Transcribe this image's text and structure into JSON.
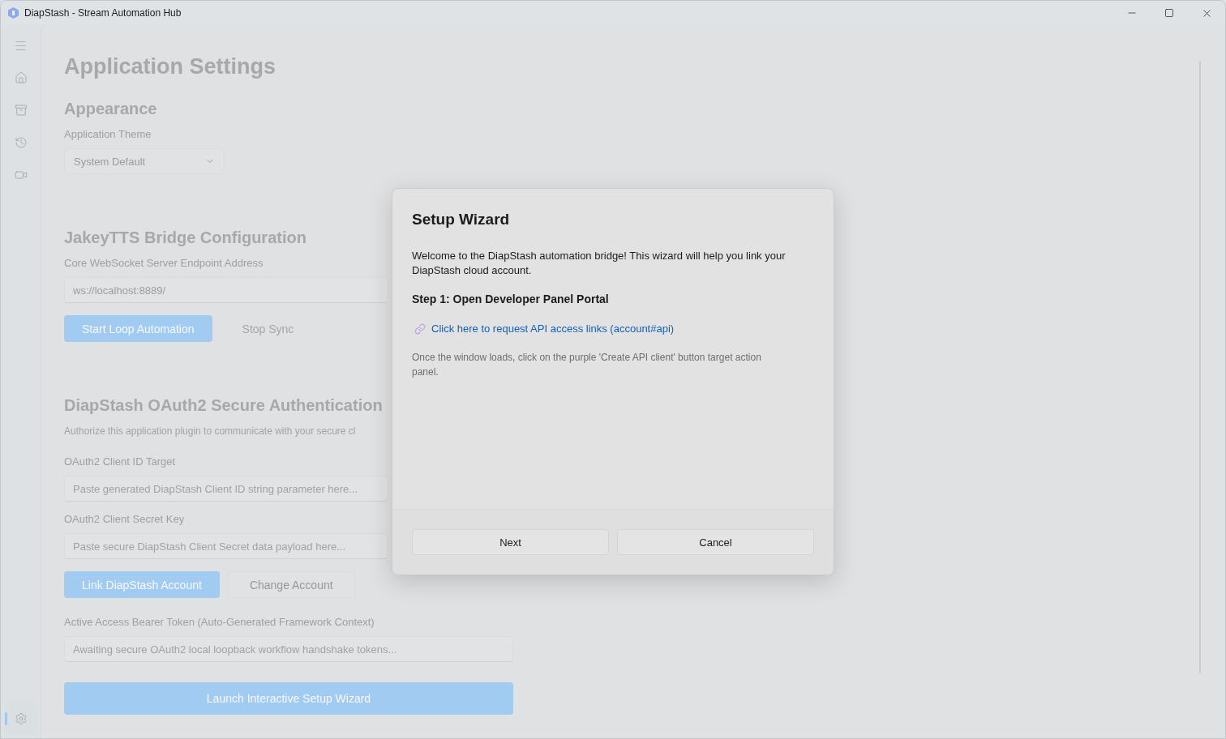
{
  "window": {
    "title": "DiapStash - Stream Automation Hub"
  },
  "nav": {
    "items": [
      {
        "selected": false
      },
      {
        "selected": false
      },
      {
        "selected": false
      },
      {
        "selected": false
      }
    ],
    "footer_items": [
      {
        "selected": true
      }
    ]
  },
  "page": {
    "title": "Application Settings",
    "sections": [
      {
        "heading": "Appearance",
        "items": [
          {
            "kind": "label",
            "text": "Application Theme"
          },
          {
            "kind": "dropdown",
            "value": "System Default"
          }
        ]
      },
      {
        "heading": "JakeyTTS Bridge Configuration",
        "items": [
          {
            "kind": "label",
            "text": "Core WebSocket Server Endpoint Address"
          },
          {
            "kind": "text_field",
            "value": "ws://localhost:8889/"
          },
          {
            "kind": "buttons",
            "buttons": [
              {
                "label": "Start Loop Automation",
                "kind": "accent",
                "disabled": false
              },
              {
                "label": "Stop Sync",
                "kind": "standard",
                "disabled": true
              }
            ]
          }
        ]
      },
      {
        "heading": "DiapStash OAuth2 Secure Authentication",
        "items": [
          {
            "kind": "description",
            "text": "Authorize this application plugin to communicate with your secure cl"
          },
          {
            "kind": "label",
            "text": "OAuth2 Client ID Target"
          },
          {
            "kind": "text_field",
            "placeholder": "Paste generated DiapStash Client ID string parameter here..."
          },
          {
            "kind": "label",
            "text": "OAuth2 Client Secret Key"
          },
          {
            "kind": "text_field",
            "placeholder": "Paste secure DiapStash Client Secret data payload here..."
          },
          {
            "kind": "buttons",
            "buttons": [
              {
                "label": "Link DiapStash Account",
                "kind": "accent",
                "disabled": false
              },
              {
                "label": "Change Account",
                "kind": "standard",
                "disabled": false
              }
            ]
          },
          {
            "kind": "label",
            "text": "Active Access Bearer Token (Auto-Generated Framework Context)"
          },
          {
            "kind": "text_field",
            "placeholder": "Awaiting secure OAuth2 local loopback workflow handshake tokens..."
          },
          {
            "kind": "wide_button",
            "label": "Launch Interactive Setup Wizard"
          }
        ]
      }
    ]
  },
  "dialog": {
    "title": "Setup Wizard",
    "body": "Welcome to the DiapStash automation bridge! This wizard will help you link your DiapStash cloud account.",
    "step_heading": "Step 1: Open Developer Panel Portal",
    "link": "Click here to request API access links (account#api)",
    "hint": "Once the window loads, click on the purple 'Create API client' button target action panel.",
    "buttons": [
      "Next",
      "Cancel"
    ]
  }
}
